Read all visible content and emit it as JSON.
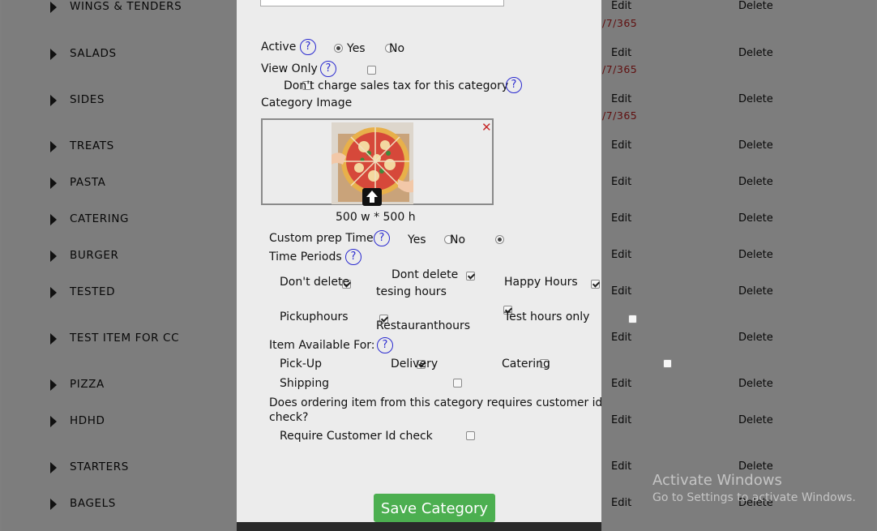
{
  "categories": [
    {
      "name": "WINGS & TENDERS",
      "edit": "Edit",
      "delete": "Delete",
      "date": "/7/365"
    },
    {
      "name": "SALADS",
      "edit": "Edit",
      "delete": "Delete",
      "date": "/7/365"
    },
    {
      "name": "SIDES",
      "edit": "Edit",
      "delete": "Delete",
      "date": "/7/365"
    },
    {
      "name": "TREATS",
      "edit": "Edit",
      "delete": "Delete"
    },
    {
      "name": "PASTA",
      "edit": "Edit",
      "delete": "Delete"
    },
    {
      "name": "CATERING",
      "edit": "Edit",
      "delete": "Delete"
    },
    {
      "name": "BURGER",
      "edit": "Edit",
      "delete": "Delete"
    },
    {
      "name": "TESTED",
      "edit": "Edit",
      "delete": "Delete"
    },
    {
      "name": "TEST ITEM FOR CC",
      "edit": "Edit",
      "delete": "Delete"
    },
    {
      "name": "PIZZA",
      "edit": "Edit",
      "delete": "Delete"
    },
    {
      "name": "HDHD",
      "edit": "Edit",
      "delete": "Delete"
    },
    {
      "name": "STARTERS",
      "edit": "Edit",
      "delete": "Delete"
    },
    {
      "name": "BAGELS",
      "edit": "Edit",
      "delete": "Delete"
    }
  ],
  "modal": {
    "active": {
      "label": "Active",
      "help": "?",
      "yes": "Yes",
      "no": "No",
      "selected": "Yes"
    },
    "view_only": {
      "label": "View Only",
      "help": "?",
      "checked": false
    },
    "no_tax": {
      "label": "Don't charge sales tax for this category",
      "help": "?",
      "checked": false
    },
    "category_image": {
      "label": "Category Image",
      "dimensions": "500 w * 500 h",
      "remove_icon": "close-icon",
      "upload_icon": "arrow-up-icon"
    },
    "custom_prep": {
      "label": "Custom prep Time",
      "help": "?",
      "yes": "Yes",
      "no": "No",
      "selected": "No"
    },
    "time_periods": {
      "label": "Time Periods",
      "help": "?",
      "items": [
        {
          "label": "Don't delete",
          "checked": true
        },
        {
          "label_line1": "Dont delete",
          "label_line2": "tesing hours",
          "checked": true
        },
        {
          "label": "Happy Hours",
          "checked": true
        },
        {
          "label": "Pickuphours",
          "checked": true
        },
        {
          "label": "Restauranthours",
          "checked": true
        },
        {
          "label": "Test hours only",
          "checked": false
        }
      ]
    },
    "available_for": {
      "label": "Item Available For:",
      "help": "?",
      "items": [
        {
          "label": "Pick-Up",
          "checked": true
        },
        {
          "label": "Delivery",
          "checked": false
        },
        {
          "label": "Catering",
          "checked": false
        },
        {
          "label": "Shipping",
          "checked": false
        }
      ]
    },
    "id_check": {
      "question_line1": "Does ordering item from this category requires customer id",
      "question_line2": "check?",
      "label": "Require Customer Id check",
      "checked": false
    },
    "save_label": "Save Category"
  },
  "watermark": {
    "title": "Activate Windows",
    "subtitle": "Go to Settings to activate Windows."
  },
  "colors": {
    "accent_green": "#4caf50",
    "help_blue": "#2b2bd0",
    "remove_red": "#c62828",
    "date_red": "#c02020"
  }
}
